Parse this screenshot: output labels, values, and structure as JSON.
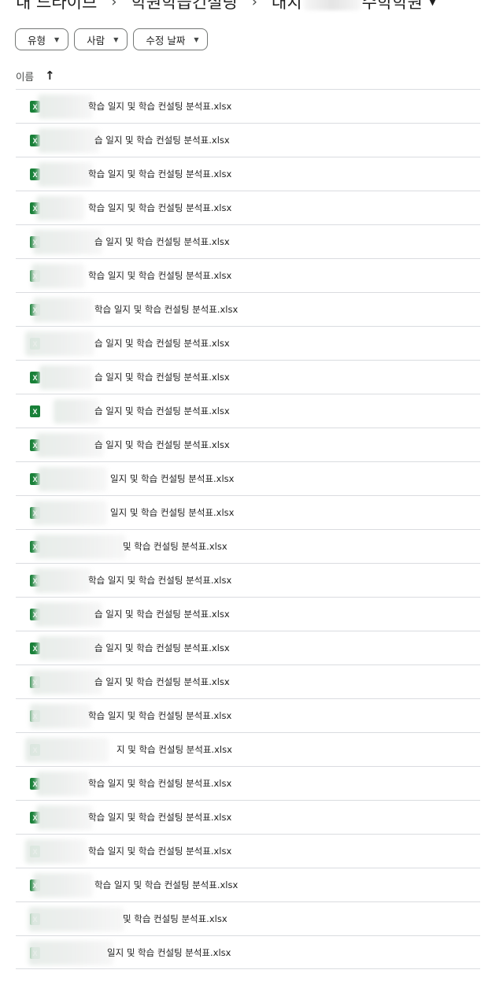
{
  "breadcrumb": {
    "root": "내 드라이브",
    "folder": "학원학습컨설팅",
    "current_prefix": "대치",
    "current_suffix": "수학학원",
    "separator": "›",
    "dropdown_icon": "▼"
  },
  "filters": [
    {
      "label": "유형",
      "caret": "▼"
    },
    {
      "label": "사람",
      "caret": "▼"
    },
    {
      "label": "수정 날짜",
      "caret": "▼"
    }
  ],
  "list_header": {
    "name_label": "이름",
    "sort_icon": "↑"
  },
  "file_icon": {
    "label": "X",
    "color": "#188038"
  },
  "files": [
    {
      "name": "학습 일지 및 학습 컨설팅 분석표.xlsx"
    },
    {
      "name": "습 일지 및 학습 컨설팅 분석표.xlsx"
    },
    {
      "name": "학습 일지 및 학습 컨설팅 분석표.xlsx"
    },
    {
      "name": "학습 일지 및 학습 컨설팅 분석표.xlsx"
    },
    {
      "name": "습 일지 및 학습 컨설팅 분석표.xlsx"
    },
    {
      "name": "학습 일지 및 학습 컨설팅 분석표.xlsx"
    },
    {
      "name": "학습 일지 및 학습 컨설팅 분석표.xlsx"
    },
    {
      "name": "습 일지 및 학습 컨설팅 분석표.xlsx"
    },
    {
      "name": "습 일지 및 학습 컨설팅 분석표.xlsx"
    },
    {
      "name": "습 일지 및 학습 컨설팅 분석표.xlsx"
    },
    {
      "name": "습 일지 및 학습 컨설팅 분석표.xlsx"
    },
    {
      "name": "일지 및 학습 컨설팅 분석표.xlsx"
    },
    {
      "name": "일지 및 학습 컨설팅 분석표.xlsx"
    },
    {
      "name": "및 학습 컨설팅 분석표.xlsx"
    },
    {
      "name": "학습 일지 및 학습 컨설팅 분석표.xlsx"
    },
    {
      "name": "습 일지 및 학습 컨설팅 분석표.xlsx"
    },
    {
      "name": "습 일지 및 학습 컨설팅 분석표.xlsx"
    },
    {
      "name": "습 일지 및 학습 컨설팅 분석표.xlsx"
    },
    {
      "name": "학습 일지 및 학습 컨설팅 분석표.xlsx"
    },
    {
      "name": "지 및 학습 컨설팅 분석표.xlsx"
    },
    {
      "name": "학습 일지 및 학습 컨설팅 분석표.xlsx"
    },
    {
      "name": "학습 일지 및 학습 컨설팅 분석표.xlsx"
    },
    {
      "name": "학습 일지 및 학습 컨설팅 분석표.xlsx"
    },
    {
      "name": "학습 일지 및 학습 컨설팅 분석표.xlsx"
    },
    {
      "name": "및 학습 컨설팅 분석표.xlsx"
    },
    {
      "name": "일지 및 학습 컨설팅 분석표.xlsx"
    }
  ]
}
